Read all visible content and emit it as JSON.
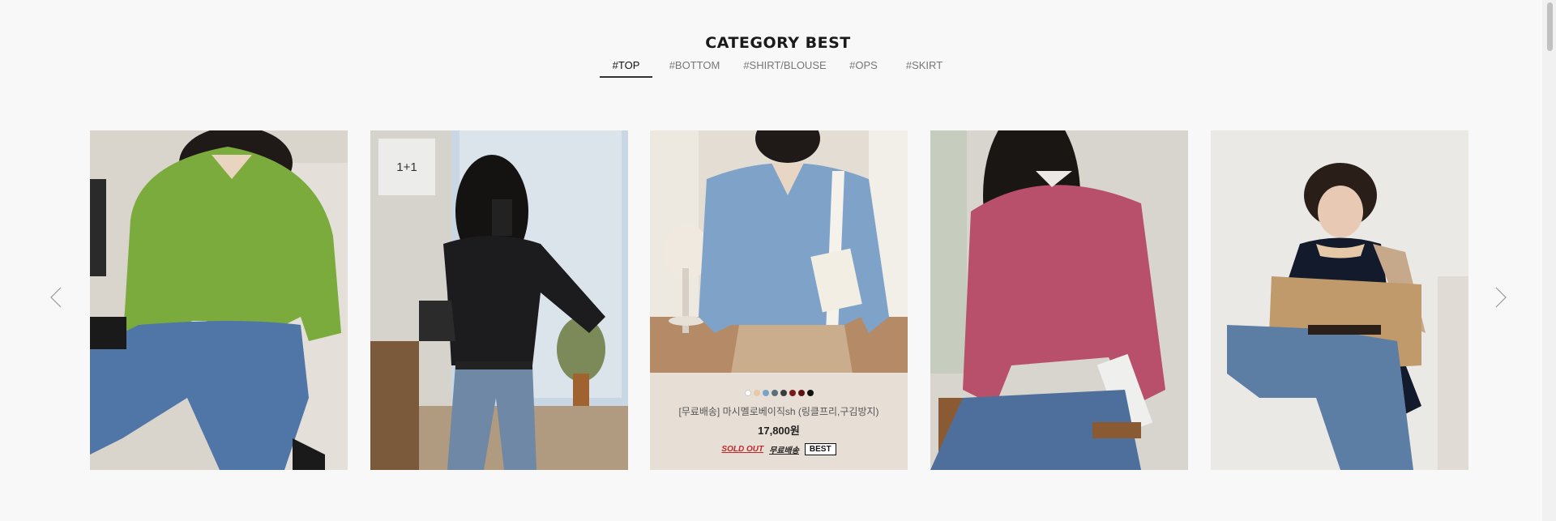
{
  "section": {
    "title": "CATEGORY BEST"
  },
  "tabs": [
    {
      "label": "#TOP",
      "active": true
    },
    {
      "label": "#BOTTOM",
      "active": false
    },
    {
      "label": "#SHIRT/BLOUSE",
      "active": false
    },
    {
      "label": "#OPS",
      "active": false
    },
    {
      "label": "#SKIRT",
      "active": false
    }
  ],
  "carousel": {
    "prev_icon": "chevron-left-icon",
    "next_icon": "chevron-right-icon"
  },
  "products": [
    {
      "image": "green cardigan photo"
    },
    {
      "image": "black long-sleeve top photo",
      "badge": "1+1"
    },
    {
      "image": "blue shirt photo",
      "name": "[무료배송] 마시멜로베이직sh (링클프리,구김방지)",
      "price": "17,800원",
      "sold_out": "SOLD OUT",
      "free_shipping": "무료배송",
      "best": "BEST",
      "colors": [
        "#ffffff",
        "#e5c9a8",
        "#7ba3c7",
        "#5b6e7e",
        "#3d3d3d",
        "#7a1a1a",
        "#5a1212",
        "#111111"
      ]
    },
    {
      "image": "pink cardigan photo"
    },
    {
      "image": "navy knit top photo"
    }
  ],
  "colors": {
    "background": "#f8f8f8",
    "sold_out": "#c0282b",
    "accent": "#222222"
  }
}
